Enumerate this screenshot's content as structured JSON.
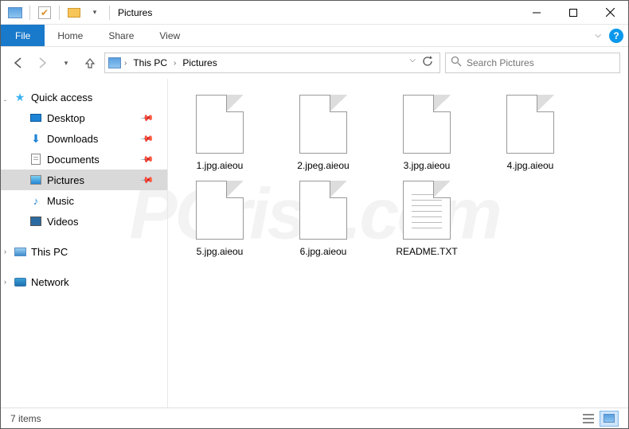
{
  "window": {
    "title": "Pictures"
  },
  "ribbon": {
    "file": "File",
    "tabs": [
      "Home",
      "Share",
      "View"
    ]
  },
  "breadcrumbs": [
    "This PC",
    "Pictures"
  ],
  "search": {
    "placeholder": "Search Pictures"
  },
  "sidebar": {
    "quick_access": "Quick access",
    "items": [
      {
        "label": "Desktop",
        "pinned": true
      },
      {
        "label": "Downloads",
        "pinned": true
      },
      {
        "label": "Documents",
        "pinned": true
      },
      {
        "label": "Pictures",
        "pinned": true,
        "selected": true
      },
      {
        "label": "Music",
        "pinned": false
      },
      {
        "label": "Videos",
        "pinned": false
      }
    ],
    "this_pc": "This PC",
    "network": "Network"
  },
  "files": [
    {
      "name": "1.jpg.aieou",
      "type": "blank"
    },
    {
      "name": "2.jpeg.aieou",
      "type": "blank"
    },
    {
      "name": "3.jpg.aieou",
      "type": "blank"
    },
    {
      "name": "4.jpg.aieou",
      "type": "blank"
    },
    {
      "name": "5.jpg.aieou",
      "type": "blank"
    },
    {
      "name": "6.jpg.aieou",
      "type": "blank"
    },
    {
      "name": "README.TXT",
      "type": "txt"
    }
  ],
  "statusbar": {
    "count": "7 items"
  },
  "help_char": "?"
}
